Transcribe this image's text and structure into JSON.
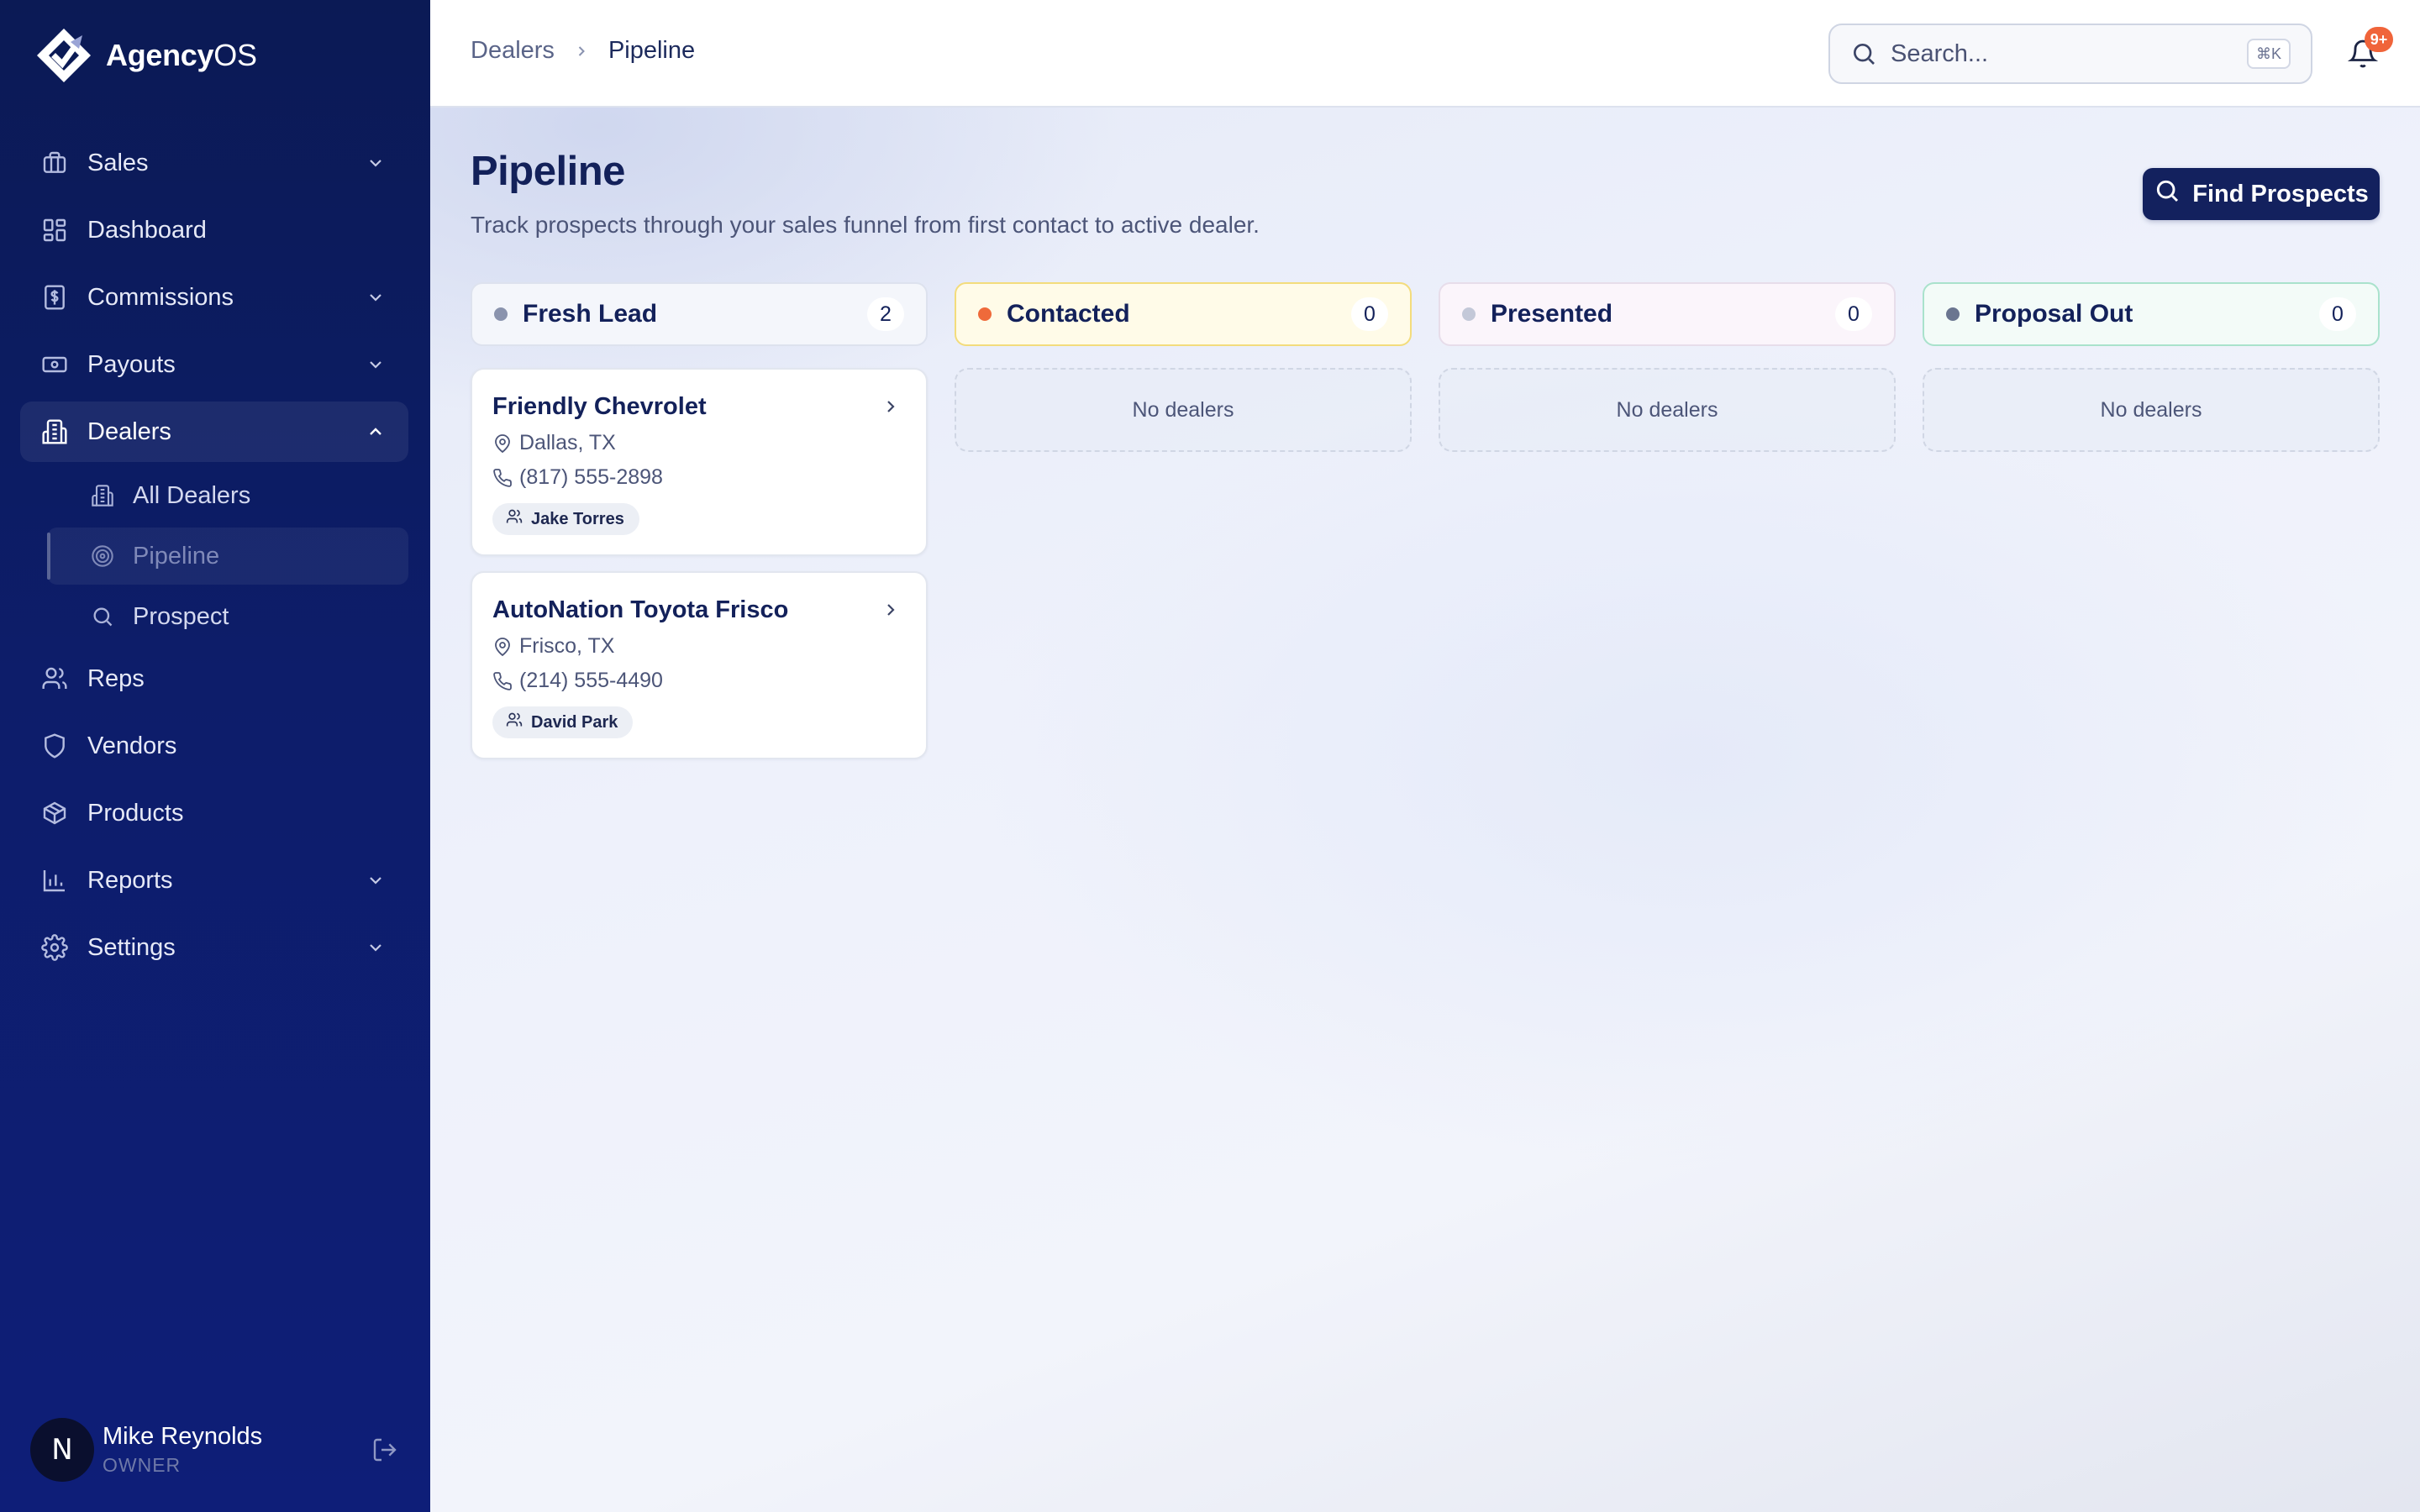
{
  "brand": {
    "name_bold": "Agency",
    "name_light": "OS"
  },
  "sidebar": {
    "items": [
      {
        "label": "Sales"
      },
      {
        "label": "Dashboard"
      },
      {
        "label": "Commissions"
      },
      {
        "label": "Payouts"
      },
      {
        "label": "Dealers"
      },
      {
        "label": "Reps"
      },
      {
        "label": "Vendors"
      },
      {
        "label": "Products"
      },
      {
        "label": "Reports"
      },
      {
        "label": "Settings"
      }
    ],
    "dealers_sub": [
      {
        "label": "All Dealers"
      },
      {
        "label": "Pipeline"
      },
      {
        "label": "Prospect"
      }
    ]
  },
  "user": {
    "initial": "N",
    "name": "Mike Reynolds",
    "role": "OWNER"
  },
  "header": {
    "breadcrumb": {
      "parent": "Dealers",
      "current": "Pipeline"
    },
    "search": {
      "placeholder": "Search...",
      "shortcut": "⌘K"
    },
    "notifications": {
      "badge": "9+"
    }
  },
  "page": {
    "title": "Pipeline",
    "subtitle": "Track prospects through your sales funnel from first contact to active dealer.",
    "find_button": "Find Prospects"
  },
  "columns": [
    {
      "title": "Fresh Lead",
      "count": "2",
      "dot_color": "#8a93ad"
    },
    {
      "title": "Contacted",
      "count": "0",
      "dot_color": "#ef6a3a",
      "empty": "No dealers"
    },
    {
      "title": "Presented",
      "count": "0",
      "dot_color": "#c3c8d8",
      "empty": "No dealers"
    },
    {
      "title": "Proposal Out",
      "count": "0",
      "dot_color": "#6a7590",
      "empty": "No dealers"
    }
  ],
  "cards": [
    {
      "name": "Friendly Chevrolet",
      "location": "Dallas, TX",
      "phone": "(817) 555-2898",
      "rep": "Jake Torres"
    },
    {
      "name": "AutoNation Toyota Frisco",
      "location": "Frisco, TX",
      "phone": "(214) 555-4490",
      "rep": "David Park"
    }
  ],
  "colors": {
    "sidebar_bg": "#0d1d6a",
    "primary_button": "#13215e",
    "badge": "#f0643a"
  },
  "icons": [
    "logo-icon",
    "briefcase-icon",
    "dashboard-icon",
    "commissions-icon",
    "payouts-icon",
    "building-icon",
    "target-icon",
    "search-icon",
    "users-icon",
    "shield-icon",
    "package-icon",
    "bar-chart-icon",
    "gear-icon",
    "logout-icon",
    "bell-icon",
    "map-pin-icon",
    "phone-icon",
    "chevron-down-icon",
    "chevron-up-icon",
    "chevron-right-icon"
  ]
}
